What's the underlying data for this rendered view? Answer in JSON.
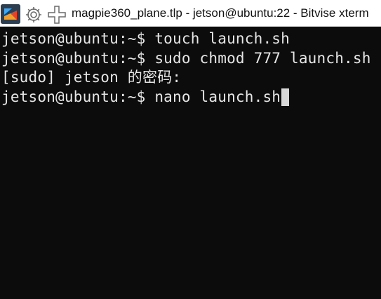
{
  "window": {
    "title": "magpie360_plane.tlp - jetson@ubuntu:22 - Bitvise xterm",
    "icons": [
      "bitvise-app-icon",
      "gear-icon",
      "move-icon"
    ]
  },
  "terminal": {
    "colors": {
      "background": "#0c0c0c",
      "foreground": "#e6e6e6",
      "cursor": "#d8d8d8"
    },
    "lines": [
      {
        "prompt": "jetson@ubuntu:~$ ",
        "command": "touch launch.sh"
      },
      {
        "prompt": "jetson@ubuntu:~$ ",
        "command": "sudo chmod 777 launch.sh"
      },
      {
        "prompt": "",
        "command": "[sudo] jetson 的密码:"
      },
      {
        "prompt": "jetson@ubuntu:~$ ",
        "command": "nano launch.sh"
      }
    ]
  }
}
